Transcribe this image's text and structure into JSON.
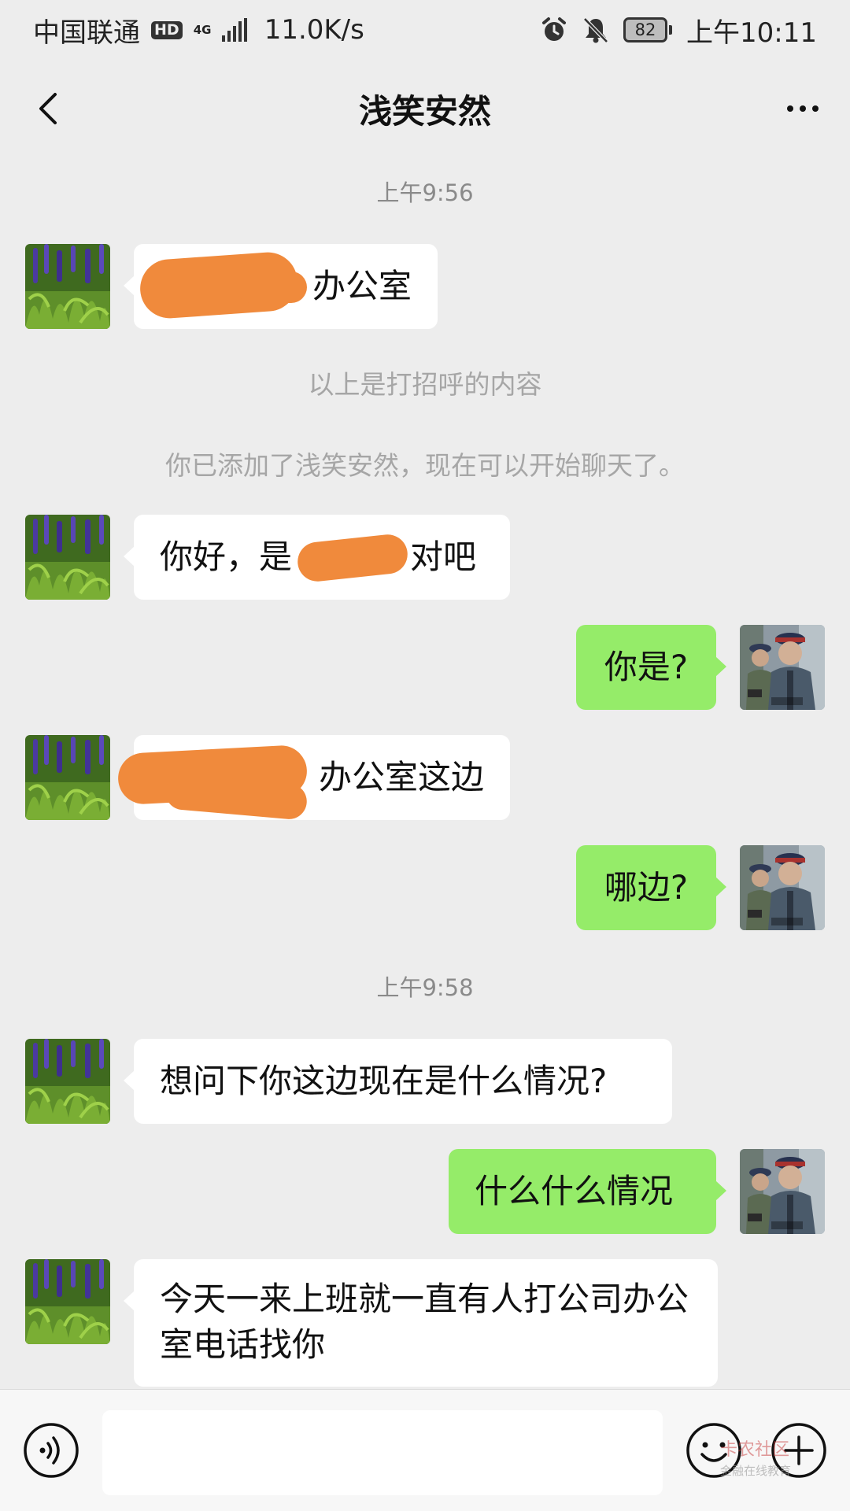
{
  "status_bar": {
    "carrier": "中国联通",
    "hd_badge": "HD",
    "network_type": "4G",
    "speed": "11.0K/s",
    "battery": "82",
    "time": "上午10:11"
  },
  "nav": {
    "title": "浅笑安然",
    "back_icon": "chevron-left-icon",
    "more_icon": "more-dots-icon"
  },
  "chat": {
    "timestamps": [
      "上午9:56",
      "上午9:58"
    ],
    "system_messages": [
      "以上是打招呼的内容",
      "你已添加了浅笑安然，现在可以开始聊天了。"
    ],
    "messages": [
      {
        "from": "contact",
        "text": "办公室"
      },
      {
        "from": "contact",
        "text_start": "你好，是",
        "text_end": "对吧"
      },
      {
        "from": "me",
        "text": "你是?"
      },
      {
        "from": "contact",
        "text": "办公室这边"
      },
      {
        "from": "me",
        "text": "哪边?"
      },
      {
        "from": "contact",
        "text": "想问下你这边现在是什么情况?"
      },
      {
        "from": "me",
        "text": "什么什么情况"
      },
      {
        "from": "contact",
        "text": "今天一来上班就一直有人打公司办公室电话找你"
      }
    ]
  },
  "input_bar": {
    "placeholder": "",
    "voice_icon": "voice-icon",
    "emoji_icon": "emoji-icon",
    "plus_icon": "plus-icon"
  },
  "watermark": {
    "line1": "卡农社区",
    "line2": "金融在线教育"
  },
  "colors": {
    "background": "#ededed",
    "outgoing_bubble": "#95ec69",
    "incoming_bubble": "#ffffff",
    "redaction": "#f08a3c"
  }
}
